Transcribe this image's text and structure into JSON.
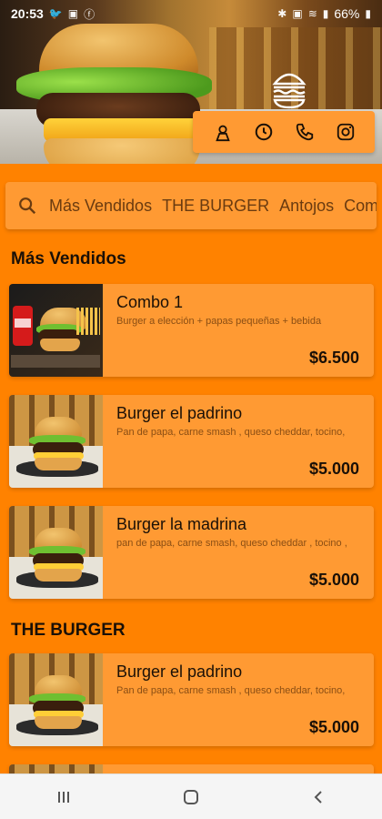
{
  "status_bar": {
    "time": "20:53",
    "left_icons": [
      "twitter-icon",
      "voicemail-icon",
      "facebook-icon"
    ],
    "right_icons": [
      "bluetooth-icon",
      "nfc-icon",
      "wifi-icon",
      "signal-icon"
    ],
    "battery": "66%"
  },
  "header": {
    "logo": "burger-logo-icon",
    "actions": [
      {
        "name": "location-icon"
      },
      {
        "name": "clock-icon"
      },
      {
        "name": "phone-icon"
      },
      {
        "name": "instagram-icon"
      }
    ]
  },
  "categories": {
    "search_icon": "search-icon",
    "items": [
      "Más Vendidos",
      "THE BURGER",
      "Antojos",
      "Com"
    ]
  },
  "sections": [
    {
      "title": "Más Vendidos",
      "items": [
        {
          "title": "Combo 1",
          "description": "Burger a elección + papas pequeñas + bebida",
          "price": "$6.500"
        },
        {
          "title": "Burger el padrino",
          "description": "Pan de papa, carne smash , queso cheddar, tocino,",
          "price": "$5.000"
        },
        {
          "title": "Burger la madrina",
          "description": "pan de papa, carne smash, queso cheddar , tocino ,",
          "price": "$5.000"
        }
      ]
    },
    {
      "title": "THE BURGER",
      "items": [
        {
          "title": "Burger el padrino",
          "description": "Pan de papa, carne smash , queso cheddar, tocino,",
          "price": "$5.000"
        }
      ]
    }
  ],
  "nav": {
    "recent": "recent-apps-icon",
    "home": "home-icon",
    "back": "back-icon"
  },
  "colors": {
    "background": "#FF8200",
    "card": "#FF9A33",
    "text": "#1a1007"
  }
}
